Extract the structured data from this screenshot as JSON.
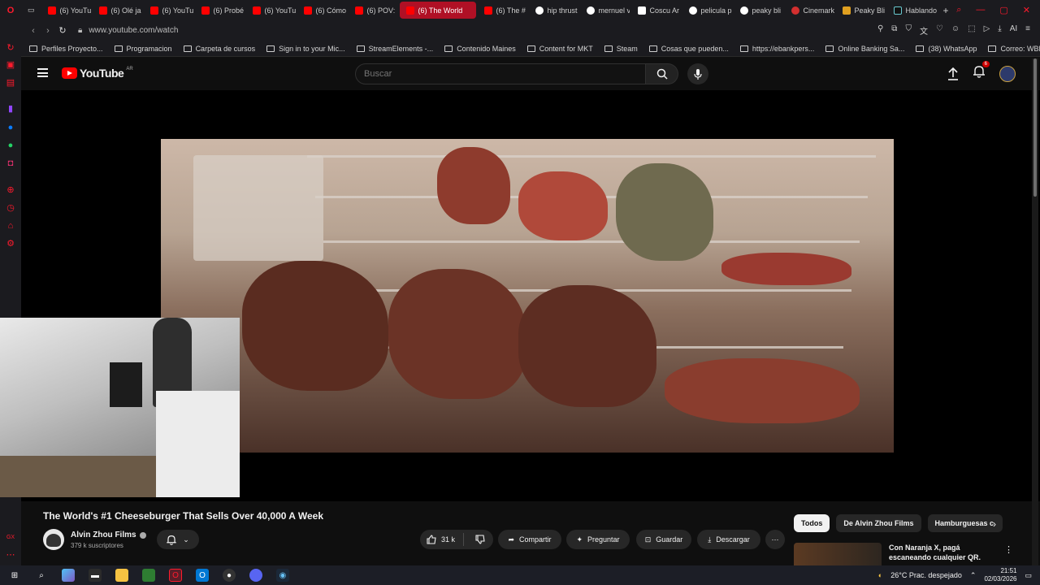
{
  "browser": {
    "tabs": [
      {
        "label": "(6) YouTu",
        "icon": "youtube-icon"
      },
      {
        "label": "(6) Olé ja",
        "icon": "youtube-icon"
      },
      {
        "label": "(6) YouTu",
        "icon": "youtube-icon"
      },
      {
        "label": "(6) Probé",
        "icon": "youtube-icon"
      },
      {
        "label": "(6) YouTu",
        "icon": "youtube-icon"
      },
      {
        "label": "(6) Cómo",
        "icon": "youtube-icon"
      },
      {
        "label": "(6) POV:",
        "icon": "youtube-icon"
      },
      {
        "label": "(6) The World",
        "icon": "youtube-icon",
        "active": true
      },
      {
        "label": "(6) The #",
        "icon": "youtube-icon"
      },
      {
        "label": "hip thrust",
        "icon": "google-icon"
      },
      {
        "label": "mernuel v",
        "icon": "google-icon"
      },
      {
        "label": "Coscu Ar",
        "icon": "wikipedia-icon"
      },
      {
        "label": "pelicula p",
        "icon": "google-icon"
      },
      {
        "label": "peaky bli",
        "icon": "google-icon"
      },
      {
        "label": "Cinemark",
        "icon": "cinemark-icon"
      },
      {
        "label": "Peaky Bli",
        "icon": "bookmark-icon"
      },
      {
        "label": "Hablando",
        "icon": "tiktok-icon"
      }
    ],
    "url": "www.youtube.com/watch",
    "bookmarks": [
      "Perfiles Proyecto...",
      "Programacion",
      "Carpeta de cursos",
      "Sign in to your Mic...",
      "StreamElements -...",
      "Contenido Maines",
      "Content for MKT",
      "Steam",
      "Cosas que pueden...",
      "https://ebankpers...",
      "Online Banking Sa...",
      "(38) WhatsApp",
      "Correo: WBL - Ga..."
    ],
    "ai_label": "AI"
  },
  "youtube": {
    "logo_text": "YouTube",
    "country": "AR",
    "search_placeholder": "Buscar",
    "notifications_count": "6",
    "video": {
      "title": "The World's #1 Cheeseburger That Sells Over 40,000 A Week",
      "channel": "Alvin Zhou Films",
      "subscribers": "379 k suscriptores",
      "likes": "31 k",
      "share_label": "Compartir",
      "ask_label": "Preguntar",
      "save_label": "Guardar",
      "download_label": "Descargar"
    },
    "chips": [
      "Todos",
      "De Alvin Zhou Films",
      "Hamburguesas c"
    ],
    "suggestion": {
      "title": "Con Naranja X, pagá escaneando cualquier QR."
    }
  },
  "taskbar": {
    "weather": "26°C  Prac. despejado",
    "time": "21:51",
    "date": "02/03/2026"
  },
  "colors": {
    "yt_red": "#ff0000",
    "active_tab": "#b01025",
    "background": "#0f0f0f"
  }
}
